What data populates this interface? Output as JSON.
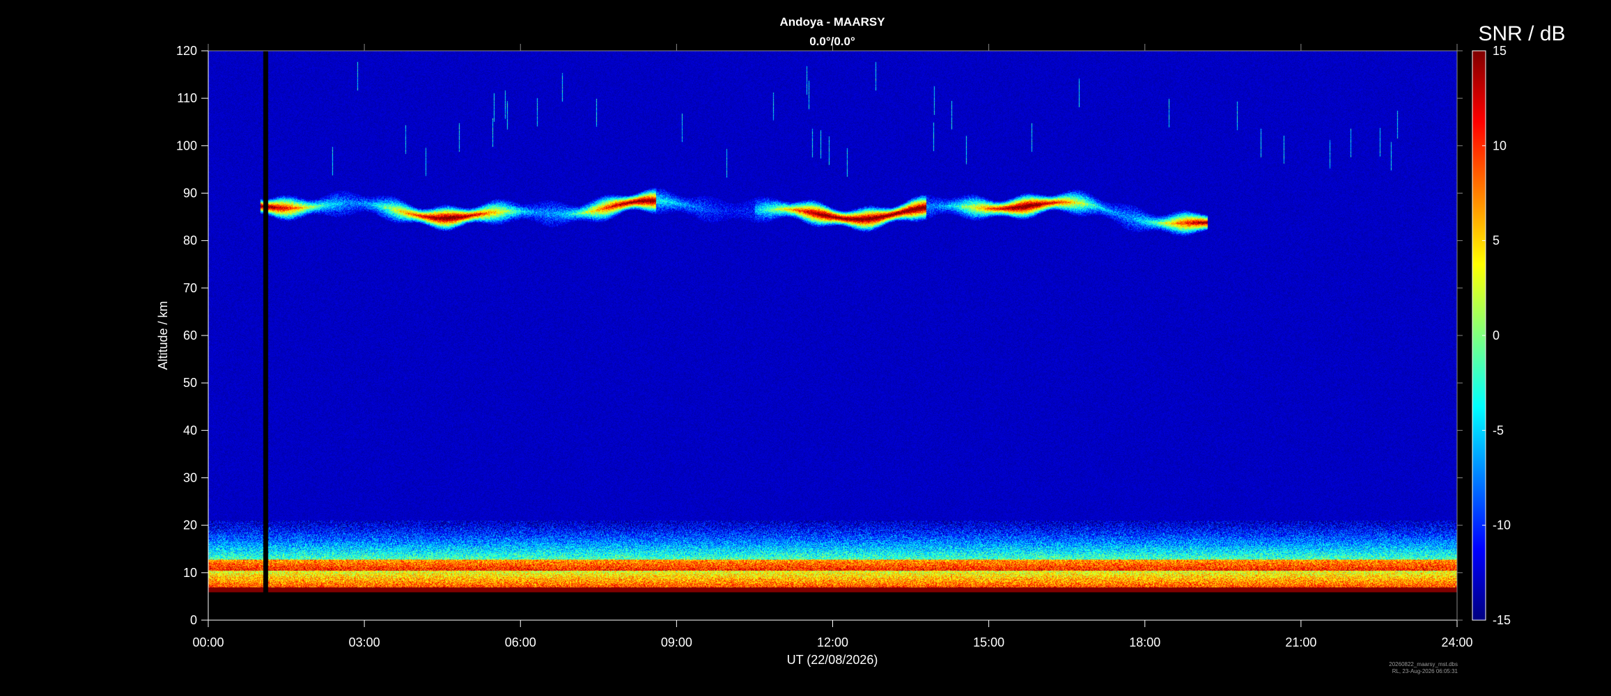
{
  "chart_data": {
    "type": "heatmap",
    "title": "Andoya - MAARSY",
    "subtitle": "0.0°/0.0°",
    "xlabel": "UT (22/08/2026)",
    "ylabel": "Altitude / km",
    "colorbar_label": "SNR / dB",
    "x_ticks": [
      "00:00",
      "03:00",
      "06:00",
      "09:00",
      "12:00",
      "15:00",
      "18:00",
      "21:00",
      "24:00"
    ],
    "xlim_hours": [
      0,
      24
    ],
    "y_ticks": [
      0,
      10,
      20,
      30,
      40,
      50,
      60,
      70,
      80,
      90,
      100,
      110,
      120
    ],
    "ylim": [
      0,
      120
    ],
    "data_altitude_range_km": [
      6,
      120
    ],
    "colorbar_ticks": [
      15,
      10,
      5,
      0,
      -5,
      -10,
      -15
    ],
    "clim": [
      -15,
      15
    ],
    "colormap": "jet",
    "background_snr_db": -13,
    "data_gap_hours": [
      1.05,
      1.15
    ],
    "features": [
      {
        "kind": "echo-layer",
        "label": "mesospheric summer echoes",
        "hours": [
          1.0,
          19.2
        ],
        "altitude_km": [
          83,
          89
        ],
        "peak_snr_db": 15
      },
      {
        "kind": "echo-layer",
        "label": "lower atmosphere",
        "hours": [
          0,
          24
        ],
        "altitude_km": [
          6,
          20
        ],
        "peak_snr_db": 15
      }
    ],
    "grid": false,
    "legend": "colorbar-right"
  },
  "footer": {
    "line1": "20260822_maarsy_mst.dbs",
    "line2": "RL, 23-Aug-2026 06:05:31"
  },
  "colors": {
    "background": "#000000",
    "axis": "#ffffff"
  }
}
